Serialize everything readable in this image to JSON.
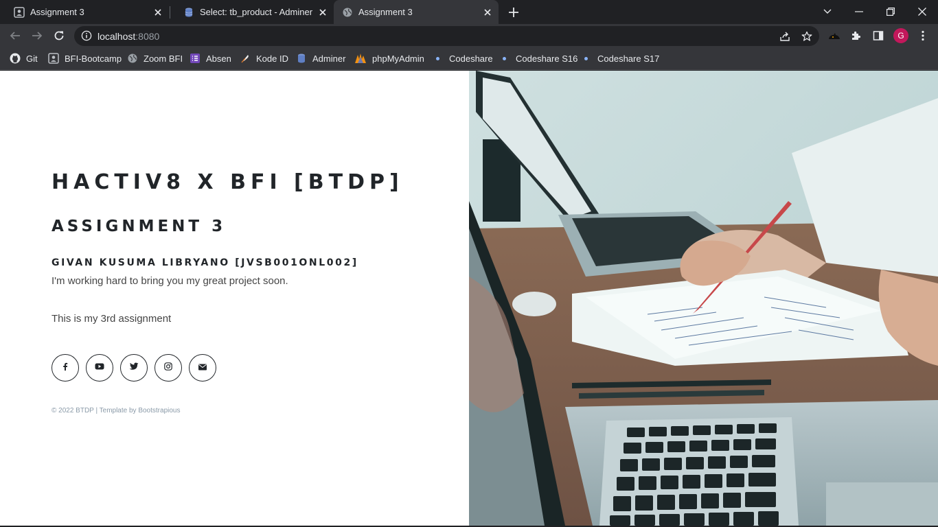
{
  "browser": {
    "tabs": [
      {
        "title": "Assignment 3",
        "active": false
      },
      {
        "title": "Select: tb_product - Adminer",
        "active": false
      },
      {
        "title": "Assignment 3",
        "active": true
      }
    ],
    "url_host": "localhost",
    "url_port": ":8080",
    "profile_initial": "G",
    "bookmarks": [
      {
        "label": "Git",
        "icon": "github-icon"
      },
      {
        "label": "BFI-Bootcamp",
        "icon": "user-page-icon"
      },
      {
        "label": "Zoom BFI",
        "icon": "globe-icon"
      },
      {
        "label": "Absen",
        "icon": "form-icon"
      },
      {
        "label": "Kode ID",
        "icon": "feather-icon"
      },
      {
        "label": "Adminer",
        "icon": "database-icon"
      },
      {
        "label": "phpMyAdmin",
        "icon": "phpmyadmin-icon"
      },
      {
        "label": "Codeshare",
        "icon": "dot-icon"
      },
      {
        "label": "Codeshare S16",
        "icon": "dot-icon"
      },
      {
        "label": "Codeshare S17",
        "icon": "dot-icon"
      }
    ]
  },
  "content": {
    "heading": "HACTIV8 X BFI [BTDP]",
    "subheading": "ASSIGNMENT 3",
    "author": "GIVAN KUSUMA LIBRYANO [JVSB001ONL002]",
    "tagline": "I'm working hard to bring you my great project soon.",
    "note": "This is my 3rd assignment",
    "social": [
      "facebook-icon",
      "youtube-icon",
      "twitter-icon",
      "instagram-icon",
      "envelope-icon"
    ],
    "footer": "© 2022 BTDP | Template by Bootstrapious"
  },
  "colors": {
    "chrome_dark": "#202124",
    "chrome_toolbar": "#35363a",
    "heading_text": "#212529",
    "avatar": "#c2185b"
  }
}
